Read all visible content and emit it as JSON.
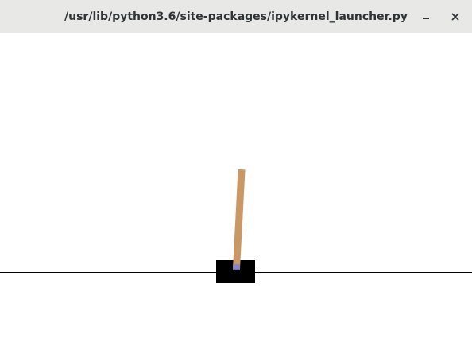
{
  "window": {
    "title": "/usr/lib/python3.6/site-packages/ipykernel_launcher.py",
    "minimize_label": "–",
    "close_label": "×"
  },
  "scene": {
    "background_color": "#ffffff",
    "track_color": "#000000",
    "cart_color": "#000000",
    "pole_color": "#ca9865",
    "axle_color": "#8184cb",
    "pole_angle_deg": 3
  }
}
